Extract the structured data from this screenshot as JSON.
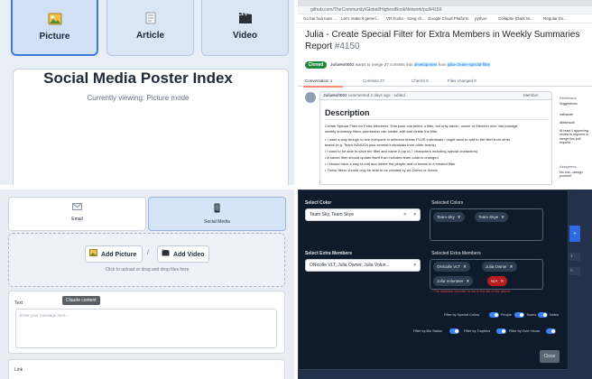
{
  "panel1": {
    "cards": [
      {
        "label": "Picture",
        "icon": "picture-icon"
      },
      {
        "label": "Article",
        "icon": "article-icon"
      },
      {
        "label": "Video",
        "icon": "video-icon"
      }
    ],
    "title": "Social Media Poster Index",
    "subtitle": "Currently viewing: Picture mode"
  },
  "panel2": {
    "url": "github.com/TheCommunity/Global/HighestBookNetwork/pull/4150",
    "bookmarks": [
      "Gu bai hua tuan ...",
      "Let's make it generi...",
      "VR.Kodio - Song ch...",
      "Google Cloud Platform",
      "python",
      "Collapse (Dark M...",
      "Regular Ex..."
    ],
    "title": "Julia - Create Special Filter for Extra Members in Weekly Summaries Report",
    "number": "#4150",
    "status": "Closed",
    "merge_user": "JuliaHolt002",
    "merge_text": "wants to merge 27 commits into",
    "merge_base": "development",
    "merge_from": "from",
    "merge_head": "julia-create-special-filter",
    "tabs": [
      {
        "label": "Conversation",
        "count": "1"
      },
      {
        "label": "Commits",
        "count": "27"
      },
      {
        "label": "Checks",
        "count": "6"
      },
      {
        "label": "Files changed",
        "count": "8"
      }
    ],
    "comment_user": "JuliaHolt002",
    "comment_meta": "commented 2 days ago · edited",
    "comment_role": "Member",
    "heading": "Description",
    "paragraphs": [
      "Create Special Filter for Extra Members. Everyone can select a filter, but only admin, owner or Member who has manage",
      "weekly summary filters permission can create, edit and delete the filter.",
      "• I want a way though to see everyone in selected teams PLUS individuals I might want to add to the filter from other",
      "  teams (e.g. Team NZWZ04 plus several individuals from other teams)",
      "• I want to be able to save the filter and name it (up to 7 characters including special characters)",
      "• A saved filter should update itself if an included team code is changed",
      "• I should have a way to edit and delete the people and or teams in a created filter",
      "• These filters should only be able to be created by an Owner or Admin"
    ],
    "side": {
      "reviewers_label": "Reviewers",
      "suggestions": "Suggestions",
      "reviewer1": "nathanah",
      "reviewer2": "Abbbhsuth",
      "note": "At least 1 approving review is required to merge this pull request.",
      "assignees_label": "Assignees",
      "assignees_value": "No one—assign yourself"
    }
  },
  "panel3": {
    "tabs": [
      {
        "label": "Email",
        "icon": "email-icon"
      },
      {
        "label": "Social Media",
        "icon": "phone-icon"
      }
    ],
    "add_picture": "Add Picture",
    "slash": "/",
    "add_video": "Add Video",
    "drop_hint": "Click to upload or drag and drop files here",
    "text_label": "Text",
    "tooltip": "Claude content",
    "placeholder": "Enter your message here...",
    "link_label": "Link"
  },
  "panel4": {
    "select_color_label": "Select Color",
    "select_color_value": "Team Sky, Team Skye",
    "selected_colors_label": "Selected Colors",
    "color_chips": [
      "Team Sky",
      "Team Skye"
    ],
    "select_members_label": "Select Extra Members",
    "select_members_value": "ONicolle VLT, Julia Owner, Julia Volun...",
    "selected_members_label": "Selected Extra Members",
    "member_chips": [
      "ONicolle VLT",
      "Julia Owner",
      "Julia Volunteer",
      "N/A"
    ],
    "warning": "* The selected member is not in the list of the above.",
    "filter_row1": [
      "Filter by Special Colors",
      "People",
      "Teams",
      "Notes"
    ],
    "filter_row2": [
      "Filter by Bio Status",
      "Filter by Trophies",
      "Filter by Over Hours"
    ],
    "close": "Close",
    "bg_button": "+",
    "bg_numbers": [
      "1",
      "0"
    ]
  }
}
